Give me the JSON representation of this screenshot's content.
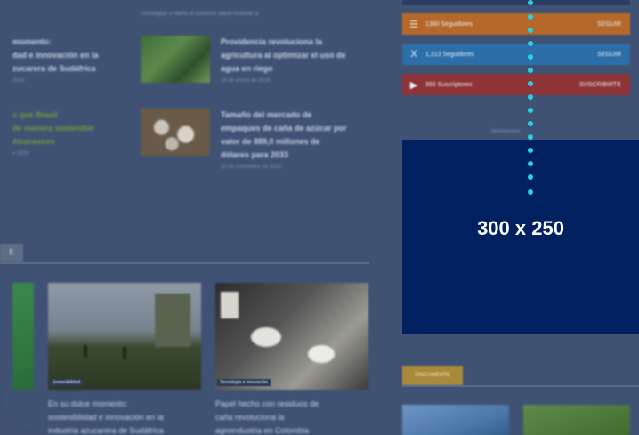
{
  "ad": {
    "size_label": "300 x 250",
    "advert_label": "Advertisement"
  },
  "top_snippet": "conseguir y darlo a conocer para motivar a",
  "left_articles": [
    {
      "title_lines": [
        "momento:",
        "dad e innovación en la",
        "zucarera de Sudáfrica"
      ],
      "date": "2024"
    },
    {
      "title_lines": [
        "s que Brasil",
        "de manera sostenible",
        "Abacaxeos"
      ],
      "date": "e 2023"
    }
  ],
  "center_articles": [
    {
      "title_lines": [
        "Providencia revoluciona la",
        "agricultura al optimizar el uso de",
        "agua en riego"
      ],
      "date": "19 de enero de 2024"
    },
    {
      "title_lines": [
        "Tamaño del mercado de",
        "empaques de caña de azúcar por",
        "valor de 889,0 millones de",
        "dólares para 2033"
      ],
      "date": "22 de noviembre de 2023"
    }
  ],
  "social": [
    {
      "icon": "rss-icon",
      "glyph": "☰",
      "count": "1380",
      "label": "Seguidores",
      "action": "SEGUIR",
      "color": "#c86b1e"
    },
    {
      "icon": "x-icon",
      "glyph": "X",
      "count": "1,313",
      "label": "Seguidores",
      "action": "SEGUIR",
      "color": "#2a76b3"
    },
    {
      "icon": "youtube-icon",
      "glyph": "▶",
      "count": "350",
      "label": "Suscriptores",
      "action": "SUSCRIBIRTE",
      "color": "#9e3237"
    }
  ],
  "section_label": "E",
  "right_section_label": "ÚNICAMENTE",
  "bottom_cards": [
    {
      "tag": "Sostenibilidad",
      "title_lines": [
        "En su dulce momento:",
        "sostenibilidad e innovación en la",
        "industria azucarera de Sudáfrica"
      ]
    },
    {
      "tag": "Tecnología e innovación",
      "title_lines": [
        "Papel hecho con residuos de",
        "caña revoluciona la",
        "agroindustria en Colombia"
      ]
    }
  ]
}
